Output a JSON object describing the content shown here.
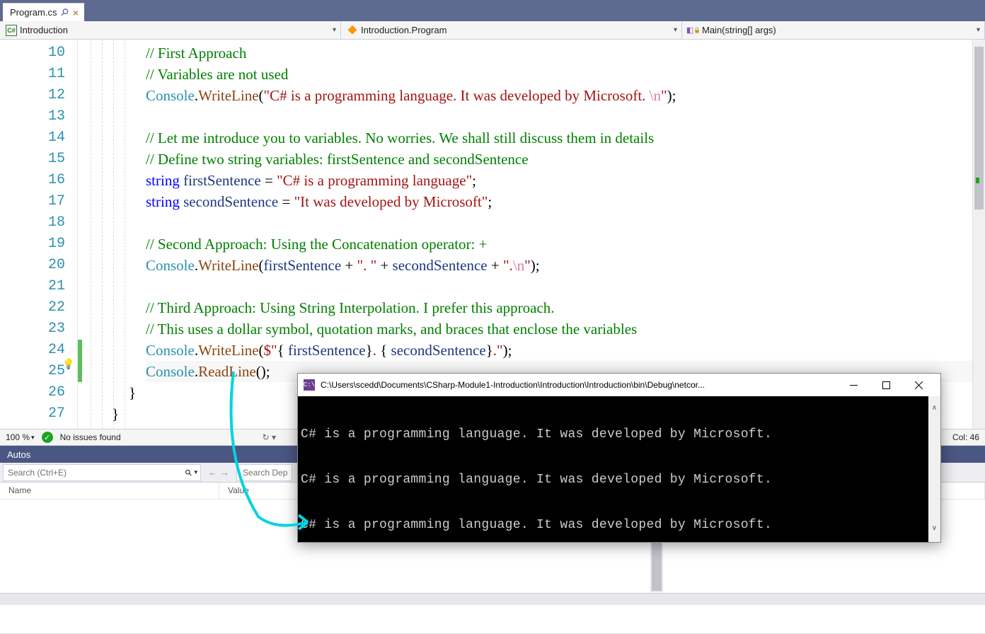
{
  "tab": {
    "filename": "Program.cs",
    "close_glyph": "×"
  },
  "nav": {
    "left": "Introduction",
    "middle": "Introduction.Program",
    "right": "Main(string[] args)"
  },
  "line_numbers": [
    "10",
    "11",
    "12",
    "13",
    "14",
    "15",
    "16",
    "17",
    "18",
    "19",
    "20",
    "21",
    "22",
    "23",
    "24",
    "25",
    "26",
    "27"
  ],
  "code": {
    "l10": "// First Approach",
    "l11": "// Variables are not used",
    "l12": {
      "pre": "Console",
      "dot1": ".",
      "m": "WriteLine",
      "p1": "(",
      "s1": "\"C# is a programming language. It was developed by Microsoft. ",
      "esc": "\\n",
      "s2": "\"",
      "p2": ");"
    },
    "l14": "// Let me introduce you to variables. No worries. We shall still discuss them in details",
    "l15": "// Define two string variables: firstSentence and secondSentence",
    "l16": {
      "kw": "string",
      "sp1": " ",
      "var": "firstSentence",
      "eq": " = ",
      "str": "\"C# is a programming language\"",
      "end": ";"
    },
    "l17": {
      "kw": "string",
      "sp1": " ",
      "var": "secondSentence",
      "eq": " = ",
      "str": "\"It was developed by Microsoft\"",
      "end": ";"
    },
    "l19": "// Second Approach: Using the Concatenation operator: +",
    "l20": {
      "pre": "Console",
      "dot1": ".",
      "m": "WriteLine",
      "p1": "(",
      "v1": "firstSentence",
      "op1": " + ",
      "s1": "\". \"",
      "op2": " + ",
      "v2": "secondSentence",
      "op3": " + ",
      "s2": "\".",
      "esc": "\\n",
      "s3": "\"",
      "p2": ");"
    },
    "l22": "// Third Approach: Using String Interpolation. I prefer this approach.",
    "l23": "// This uses a dollar symbol, quotation marks, and braces that enclose the variables",
    "l24": {
      "pre": "Console",
      "dot1": ".",
      "m": "WriteLine",
      "p1": "(",
      "d": "$\"",
      "b1": "{ ",
      "v1": "firstSentence",
      "b2": "}",
      "mid": ". ",
      "b3": "{ ",
      "v2": "secondSentence",
      "b4": "}",
      "end": ".\"",
      "p2": ");"
    },
    "l25": {
      "pre": "Console",
      "dot1": ".",
      "m": "ReadLine",
      "p": "();"
    },
    "l26": "}",
    "l27": "}"
  },
  "editor_status": {
    "zoom": "100 %",
    "issues": "No issues found",
    "col": "Col: 46"
  },
  "panel": {
    "title": "Autos",
    "search_placeholder": "Search (Ctrl+E)",
    "depth_placeholder": "Search Dep",
    "col_name": "Name",
    "col_value": "Value"
  },
  "console": {
    "title": "C:\\Users\\scedd\\Documents\\CSharp-Module1-Introduction\\Introduction\\Introduction\\bin\\Debug\\netcor...",
    "lines": [
      "C# is a programming language. It was developed by Microsoft.",
      "",
      "C# is a programming language. It was developed by Microsoft.",
      "",
      "C# is a programming language. It was developed by Microsoft."
    ]
  }
}
